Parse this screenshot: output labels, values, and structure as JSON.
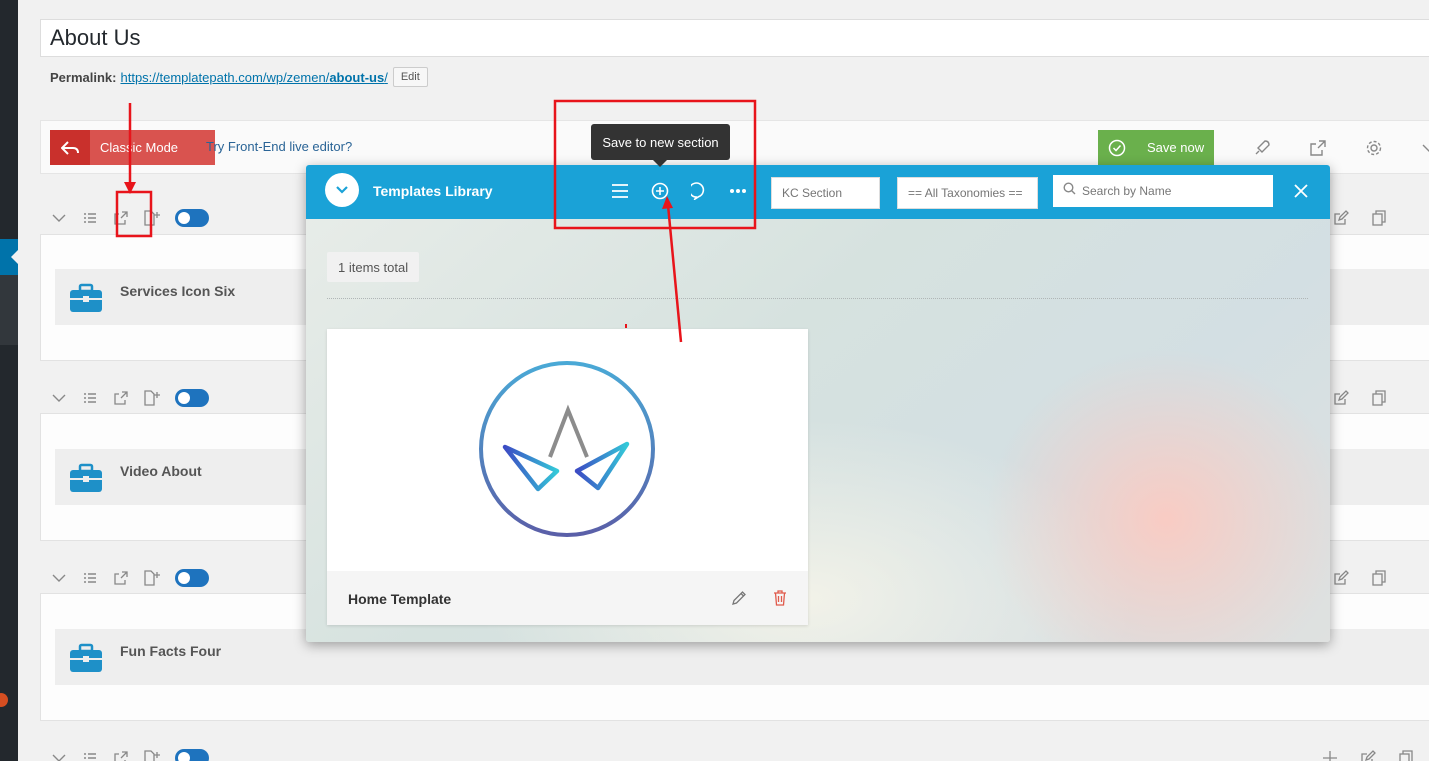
{
  "editor": {
    "post_title": "About Us",
    "permalink_label": "Permalink:",
    "permalink_base": "https://templatepath.com/wp/zemen/",
    "permalink_slug": "about-us",
    "permalink_trailing": "/",
    "edit_label": "Edit"
  },
  "toolbar": {
    "classic_mode_label": "Classic Mode",
    "frontend_link": "Try Front-End live editor?",
    "save_label": "Save now"
  },
  "rows": [
    {
      "element_label": "Services Icon Six"
    },
    {
      "element_label": "Video About"
    },
    {
      "element_label": "Fun Facts Four"
    }
  ],
  "modal": {
    "title": "Templates Library",
    "tooltip": "Save to new section",
    "section_filter_placeholder": "KC Section",
    "taxonomy_filter_placeholder": "== All Taxonomies ==",
    "search_placeholder": "Search by Name",
    "items_total": "1 items total",
    "templates": [
      {
        "name": "Home Template"
      }
    ]
  },
  "colors": {
    "header_blue": "#1aa2d7",
    "classic_red": "#d9534f",
    "save_green": "#6ab04c",
    "annotation_red": "#e8141b"
  }
}
